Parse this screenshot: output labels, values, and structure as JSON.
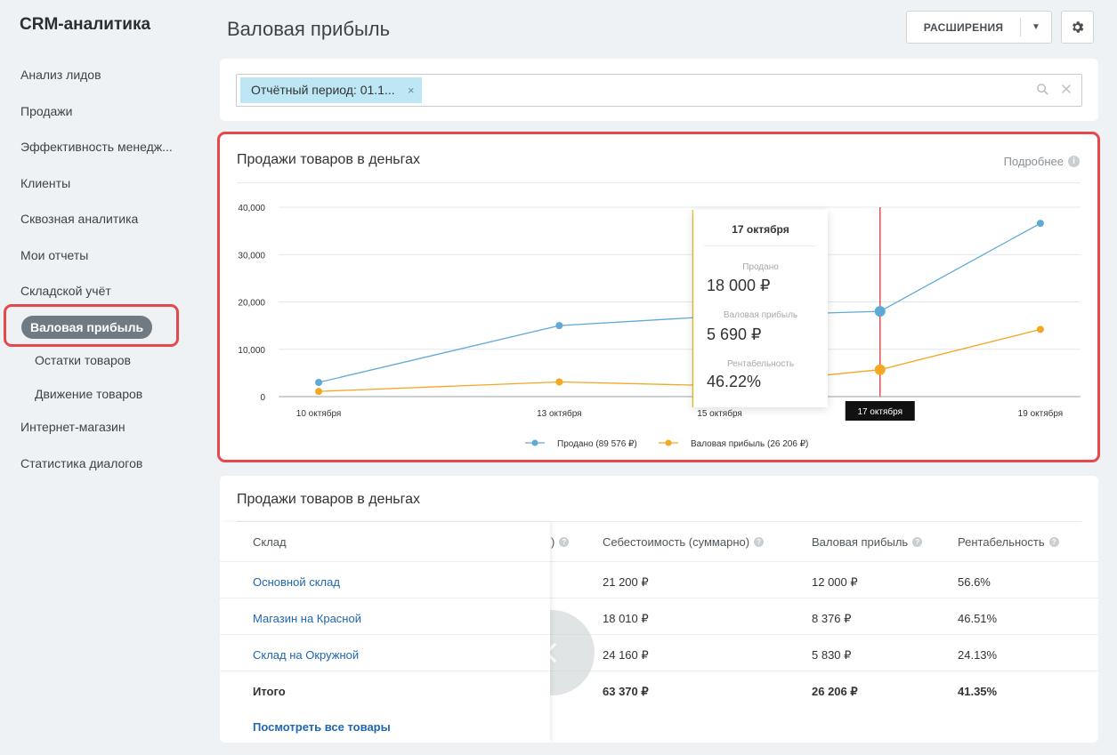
{
  "app": {
    "title": "CRM-аналитика"
  },
  "sidebar": {
    "items": [
      {
        "label": "Анализ лидов"
      },
      {
        "label": "Продажи"
      },
      {
        "label": "Эффективность менедж..."
      },
      {
        "label": "Клиенты"
      },
      {
        "label": "Сквозная аналитика"
      },
      {
        "label": "Мои отчеты"
      },
      {
        "label": "Складской учёт"
      },
      {
        "label": "Валовая прибыль",
        "active": true
      },
      {
        "label": "Остатки товаров"
      },
      {
        "label": "Движение товаров"
      },
      {
        "label": "Интернет-магазин"
      },
      {
        "label": "Статистика диалогов"
      }
    ]
  },
  "header": {
    "page_title": "Валовая прибыль",
    "extensions_label": "РАСШИРЕНИЯ",
    "dropdown_icon": "chevron-down-icon",
    "settings_icon": "gear-icon"
  },
  "filter": {
    "chip_label": "Отчётный период: 01.1...",
    "chip_remove": "×",
    "search_icon": "search-icon",
    "clear_icon": "close-icon"
  },
  "chart_card": {
    "title": "Продажи товаров в деньгах",
    "more_label": "Подробнее",
    "tooltip": {
      "date": "17 октября",
      "sold_label": "Продано",
      "sold_value": "18 000 ₽",
      "profit_label": "Валовая прибыль",
      "profit_value": "5 690 ₽",
      "margin_label": "Рентабельность",
      "margin_value": "46.22%"
    }
  },
  "chart_data": {
    "type": "line",
    "x": [
      "10 октября",
      "13 октября",
      "15 октября",
      "17 октября",
      "19 октября"
    ],
    "x_index": [
      0,
      3,
      5,
      7,
      9
    ],
    "y_ticks": [
      "0",
      "10,000",
      "20,000",
      "30,000",
      "40,000"
    ],
    "ylim": [
      0,
      40000
    ],
    "grid": true,
    "legend_position": "bottom",
    "highlighted_x": "17 октября",
    "series": [
      {
        "name": "Продано (89 576 ₽)",
        "color": "#5fa9d6",
        "values": [
          3000,
          15000,
          17000,
          18000,
          36600
        ]
      },
      {
        "name": "Валовая прибыль (26 206 ₽)",
        "color": "#f5a623",
        "values": [
          1100,
          3100,
          2300,
          5690,
          14200
        ]
      }
    ]
  },
  "table_card": {
    "title": "Продажи товаров в деньгах",
    "columns": {
      "warehouse": "Склад",
      "hidden_tail": ")",
      "cost": "Себестоимость (суммарно)",
      "profit": "Валовая прибыль",
      "margin": "Рентабельность"
    },
    "rows": [
      {
        "warehouse": "Основной склад",
        "cost": "21 200 ₽",
        "profit": "12 000 ₽",
        "margin": "56.6%"
      },
      {
        "warehouse": "Магазин на Красной",
        "cost": "18 010 ₽",
        "profit": "8 376 ₽",
        "margin": "46.51%"
      },
      {
        "warehouse": "Склад на Окружной",
        "cost": "24 160 ₽",
        "profit": "5 830 ₽",
        "margin": "24.13%"
      }
    ],
    "total": {
      "label": "Итого",
      "cost": "63 370 ₽",
      "profit": "26 206 ₽",
      "margin": "41.35%"
    },
    "view_all_label": "Посмотреть все товары",
    "scroll_icon": "chevron-left-icon"
  }
}
